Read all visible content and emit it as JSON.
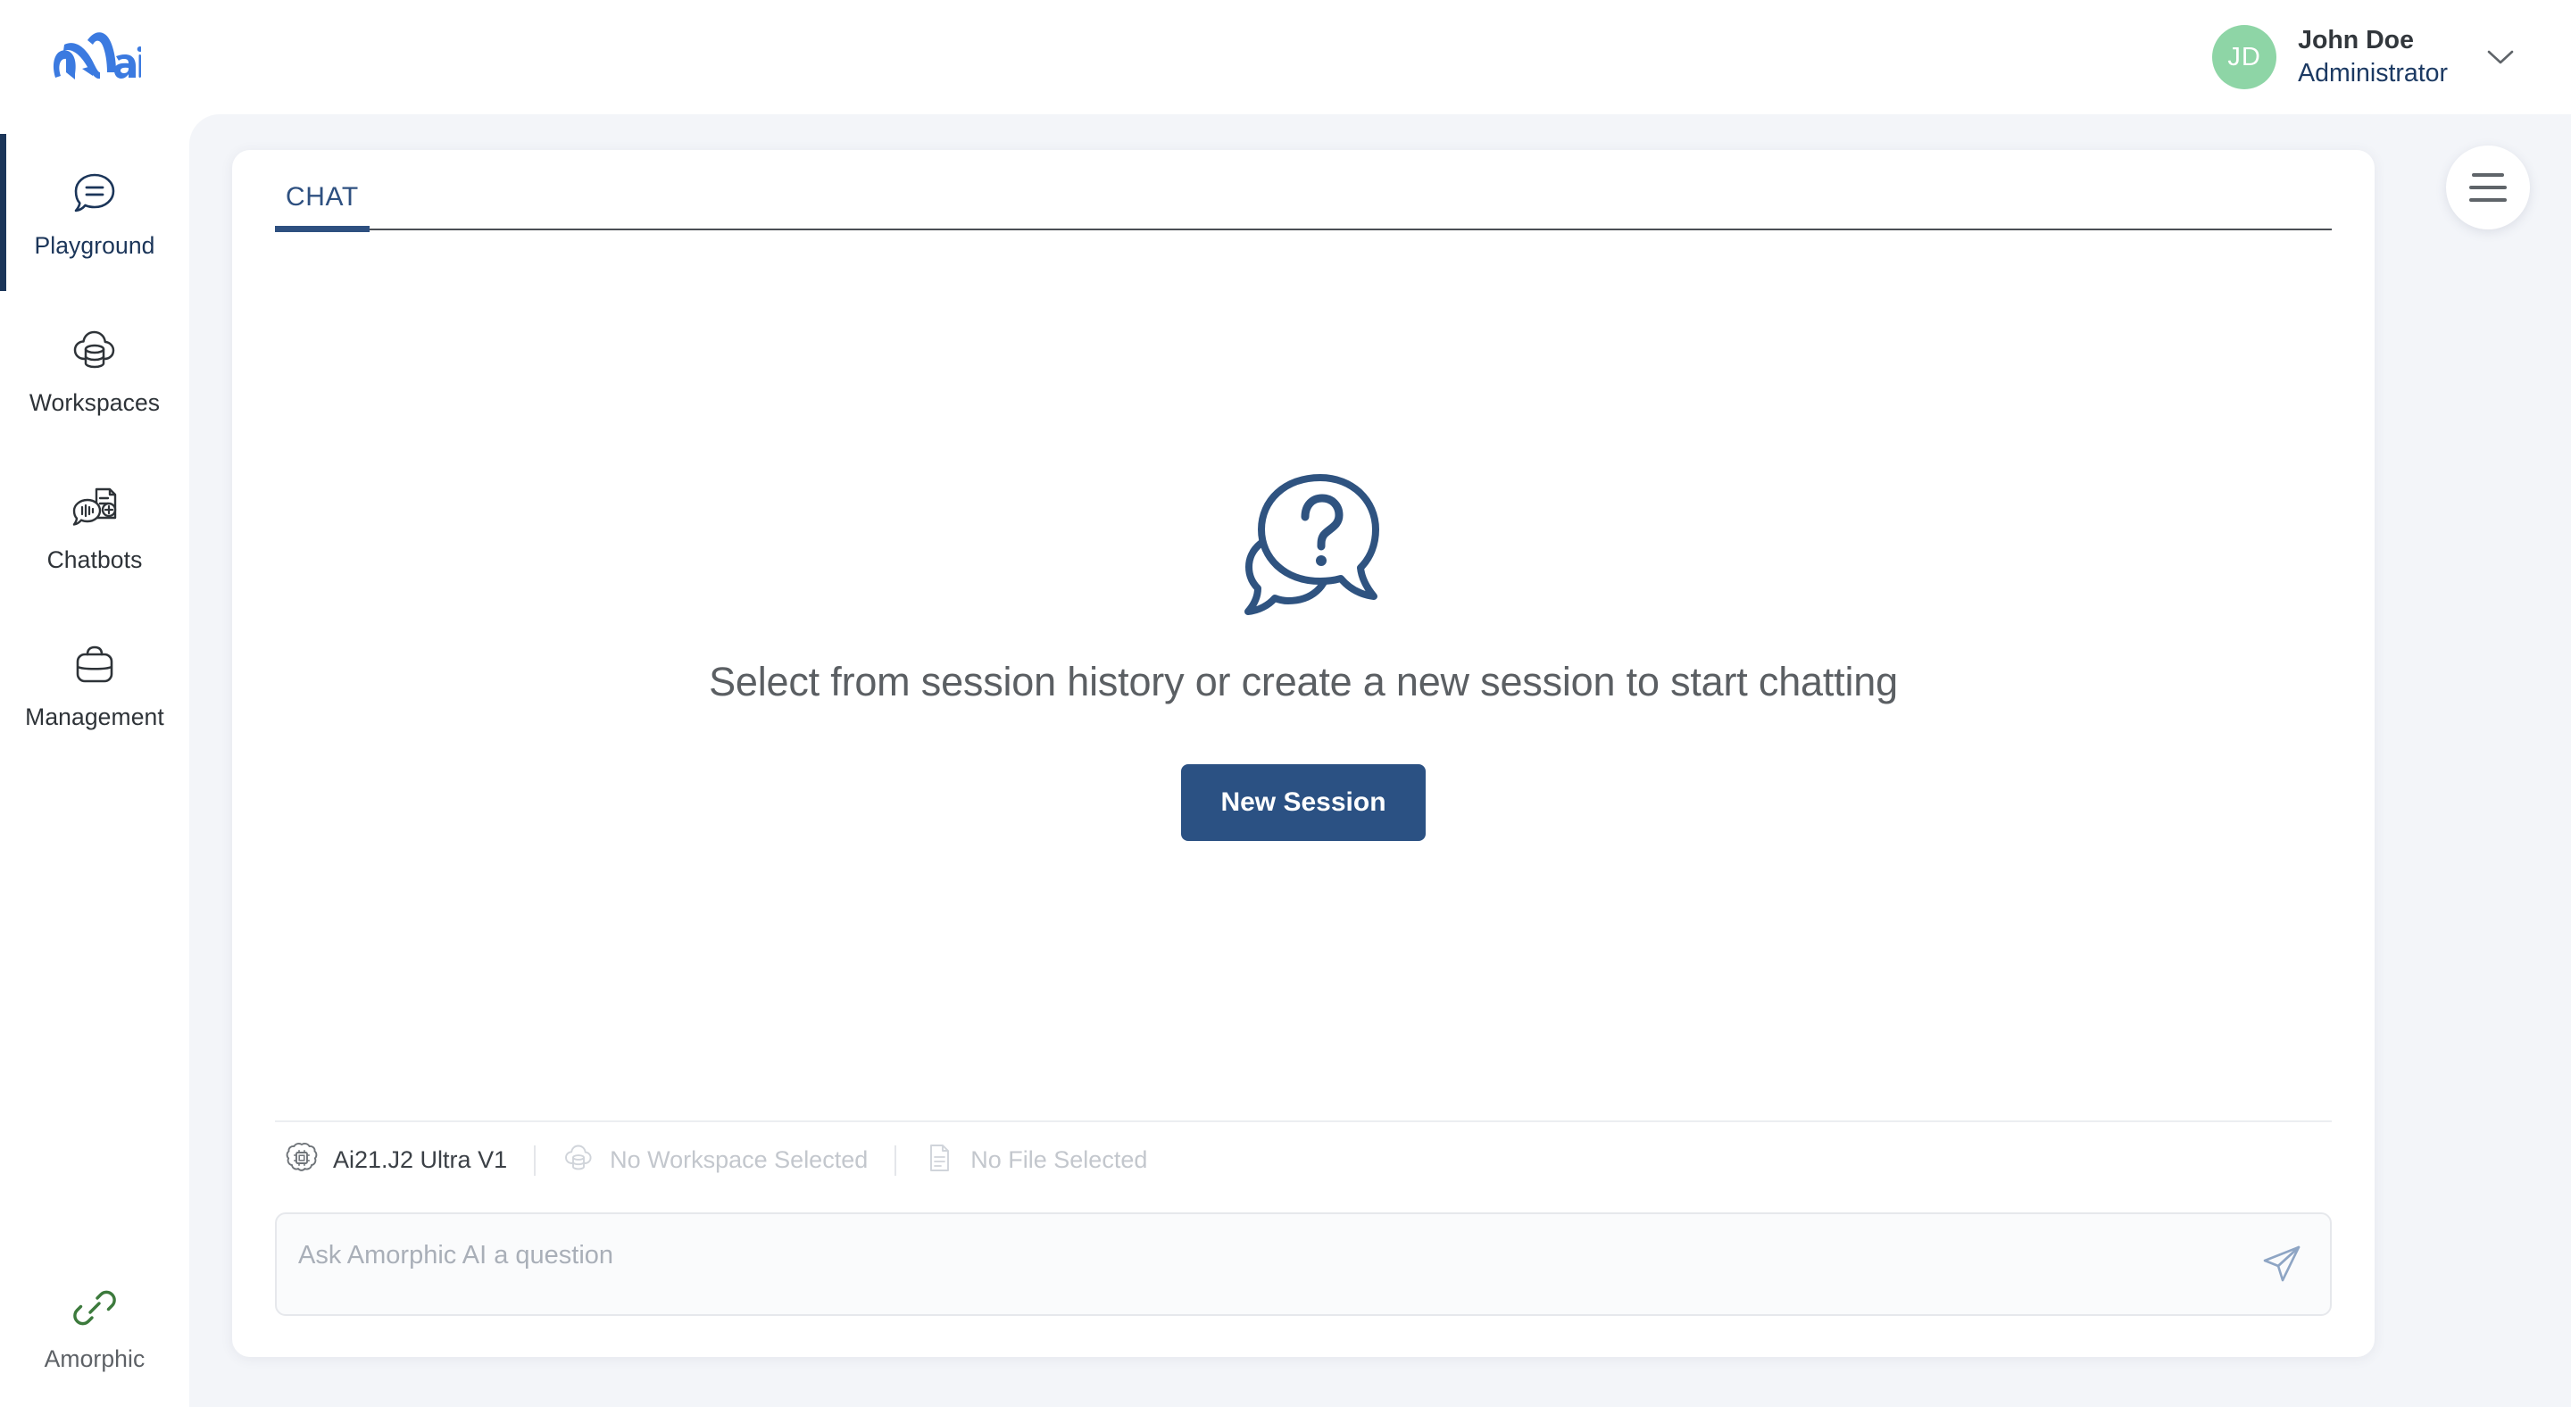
{
  "brand": {
    "logo_alt": "Amorphic ai logo",
    "logo_color": "#3b7ae0"
  },
  "topbar": {
    "user": {
      "initials": "JD",
      "name": "John Doe",
      "role": "Administrator",
      "avatar_color": "#8ed5a6"
    },
    "chevron_icon": "chevron-down-icon"
  },
  "sidebar": {
    "items": [
      {
        "label": "Playground",
        "icon": "chat-bubble-icon",
        "active": true
      },
      {
        "label": "Workspaces",
        "icon": "cloud-database-icon",
        "active": false
      },
      {
        "label": "Chatbots",
        "icon": "chatbot-document-icon",
        "active": false
      },
      {
        "label": "Management",
        "icon": "briefcase-icon",
        "active": false
      }
    ],
    "footer": {
      "label": "Amorphic",
      "icon": "link-chain-icon",
      "icon_color": "#3c7a3c"
    }
  },
  "panel": {
    "menu_button_icon": "hamburger-menu-icon",
    "tabs": [
      {
        "label": "CHAT",
        "active": true
      }
    ],
    "empty_state": {
      "illustration": "question-speech-bubbles-icon",
      "title": "Select from session history or create a new session to start chatting",
      "button_label": "New Session"
    },
    "composer": {
      "status": [
        {
          "icon": "brain-chip-icon",
          "text": "Ai21.J2 Ultra V1",
          "muted": false
        },
        {
          "icon": "cloud-database-icon",
          "text": "No Workspace Selected",
          "muted": true
        },
        {
          "icon": "file-document-icon",
          "text": "No File Selected",
          "muted": true
        }
      ],
      "input_placeholder": "Ask Amorphic AI a question",
      "input_value": "",
      "send_icon": "send-paper-plane-icon"
    }
  },
  "colors": {
    "accent": "#2b5183",
    "navy": "#1b3559",
    "page_bg": "#f3f5f9",
    "card_bg": "#ffffff"
  }
}
